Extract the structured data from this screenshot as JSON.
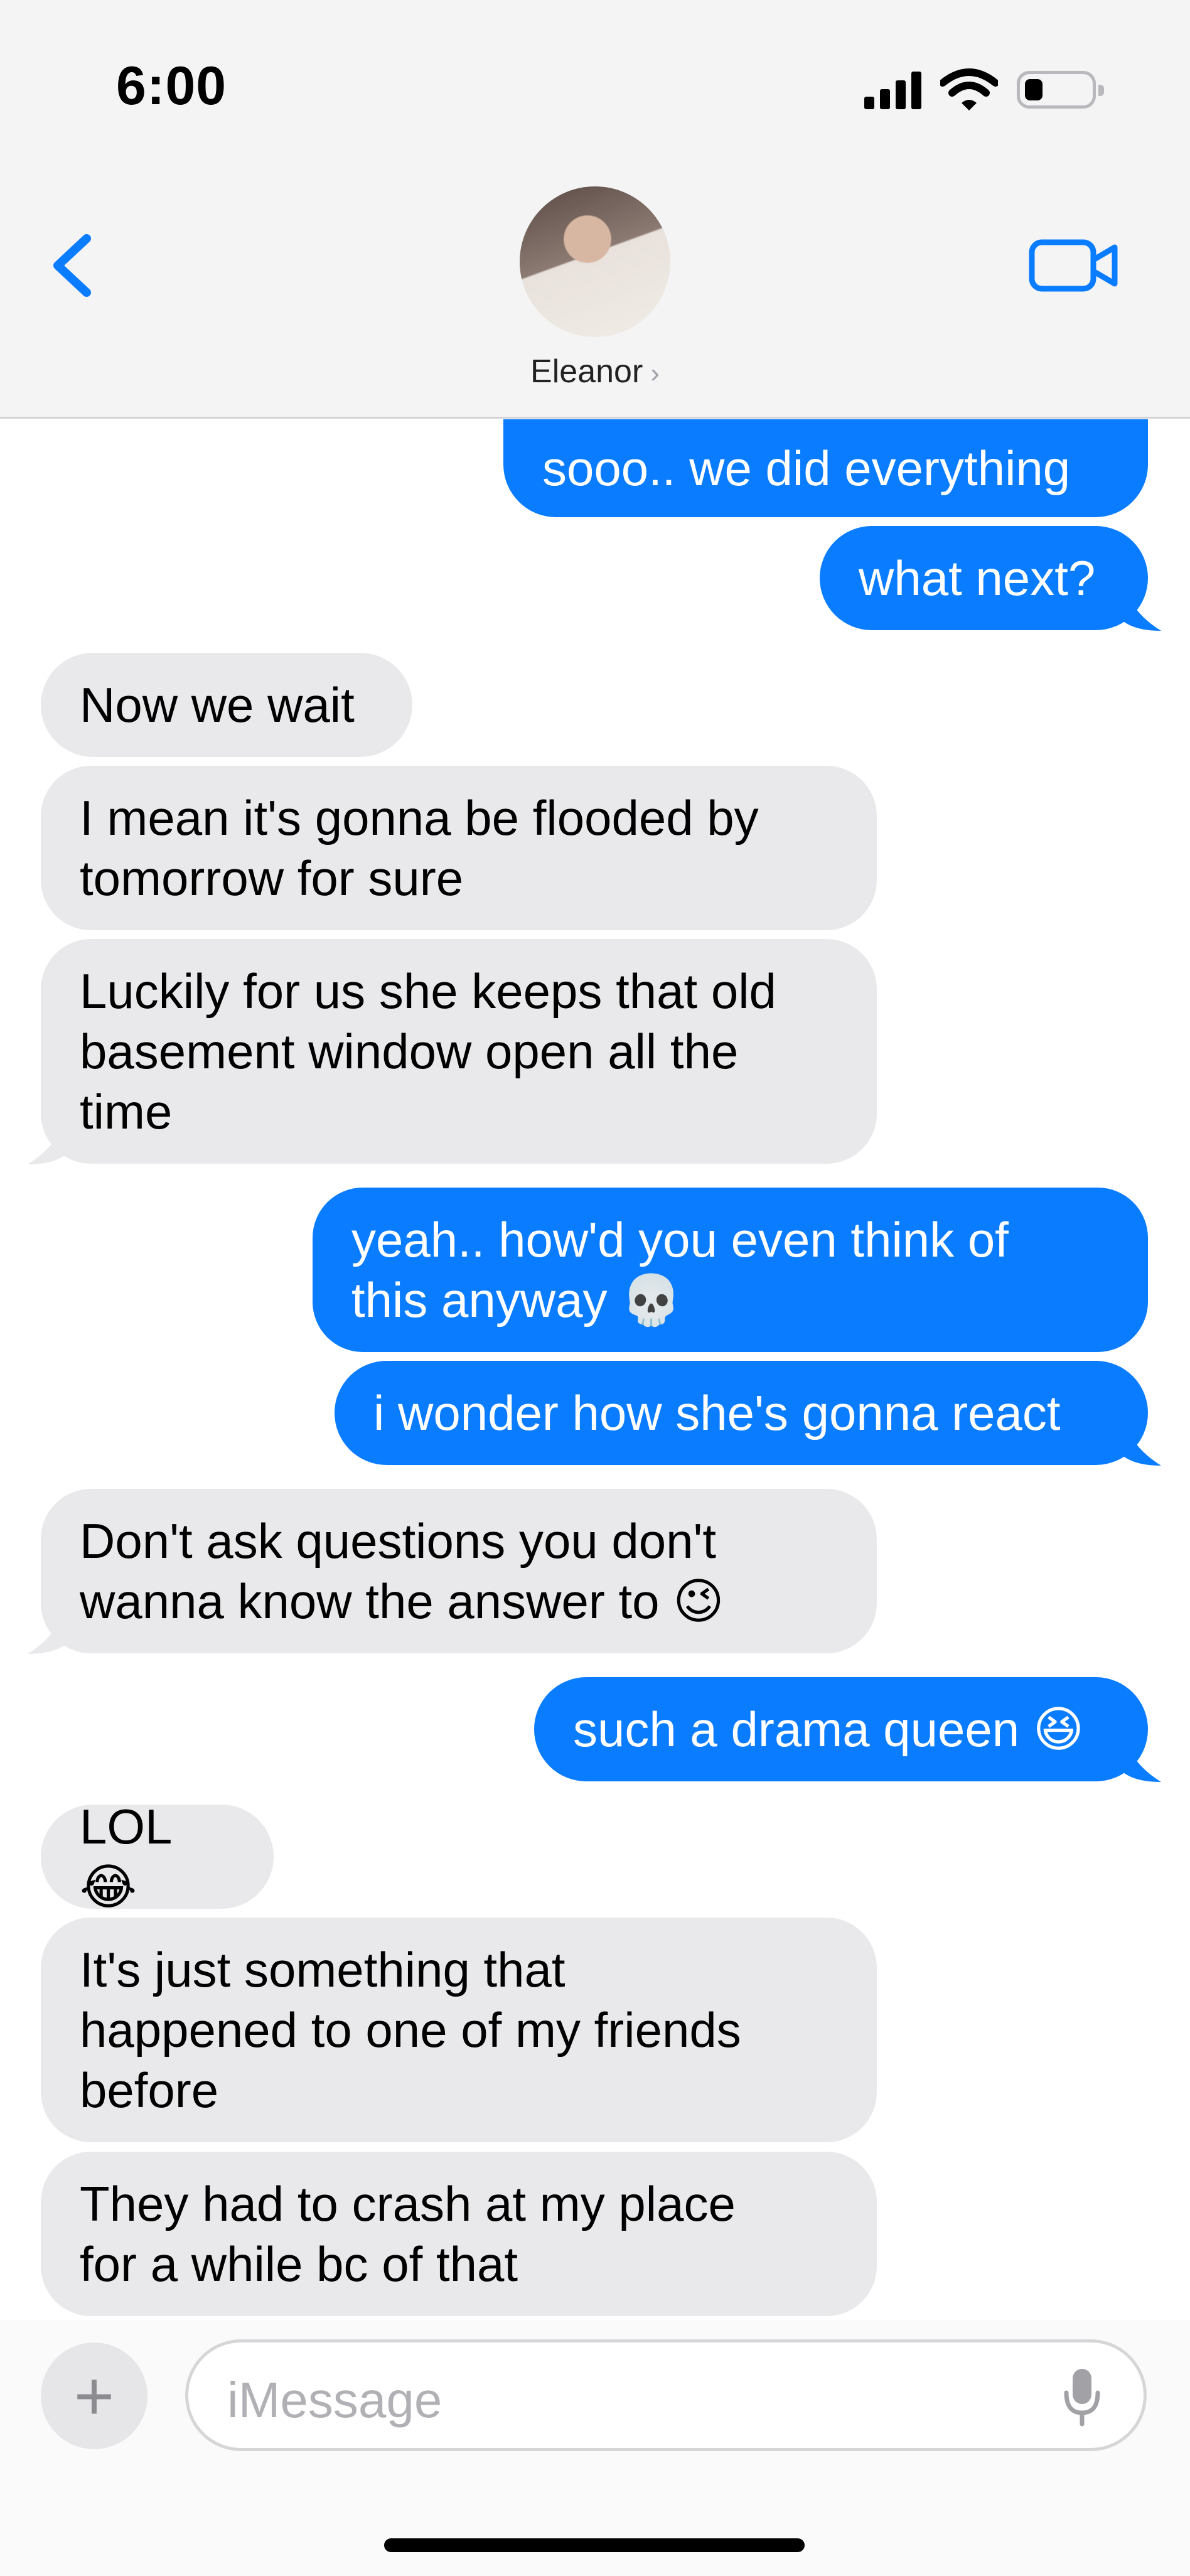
{
  "status_bar": {
    "time": "6:00"
  },
  "header": {
    "contact_name": "Eleanor",
    "chevron": "›"
  },
  "messages": [
    {
      "from": "me",
      "text": "sooo.. we did everything"
    },
    {
      "from": "me",
      "text": "what next?"
    },
    {
      "from": "them",
      "text": "Now we wait"
    },
    {
      "from": "them",
      "text": "I mean it's gonna be flooded by\ntomorrow for sure"
    },
    {
      "from": "them",
      "text": "Luckily for us she keeps that old\nbasement window open all the\ntime"
    },
    {
      "from": "me",
      "text": "yeah.. how'd you even think of\nthis anyway 💀"
    },
    {
      "from": "me",
      "text": "i wonder how she's gonna react"
    },
    {
      "from": "them",
      "text": "Don't ask questions you don't\nwanna know the answer to 😉"
    },
    {
      "from": "me",
      "text": "such a drama queen 😆"
    },
    {
      "from": "them",
      "text": "LOL 😂"
    },
    {
      "from": "them",
      "text": "It's just something that\nhappened to one of my friends\nbefore"
    },
    {
      "from": "them",
      "text": "They had to crash at my place\nfor a while bc of that"
    }
  ],
  "composer": {
    "placeholder": "iMessage",
    "plus": "+"
  },
  "colors": {
    "sent": "#0a7cff",
    "received": "#e9e9eb",
    "accent": "#0a7cff"
  },
  "icons": {
    "back": "chevron-left-icon",
    "video": "video-camera-icon",
    "mic": "microphone-icon"
  }
}
